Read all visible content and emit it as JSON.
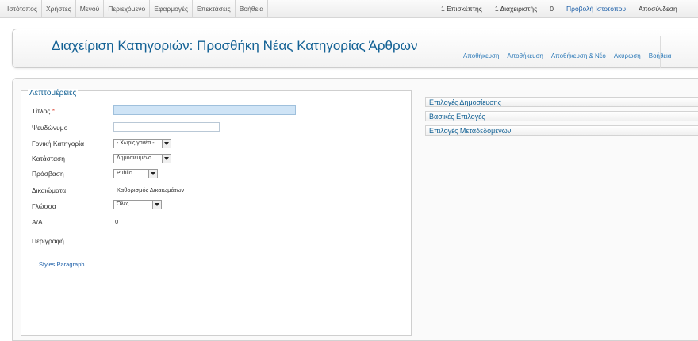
{
  "topmenu": [
    "Ιστότοπος",
    "Χρήστες",
    "Μενού",
    "Περιεχόμενο",
    "Εφαρμογές",
    "Επεκτάσεις",
    "Βοήθεια"
  ],
  "status": {
    "visitors": "1 Επισκέπτης",
    "admins": "1 Διαχειριστής",
    "messages": "0",
    "view_site": "Προβολή Ιστοτόπου",
    "logout": "Αποσύνδεση"
  },
  "header": {
    "title": "Διαχείριση Κατηγοριών: Προσθήκη Νέας Κατηγορίας Άρθρων",
    "toolbar": [
      "Αποθήκευση",
      "Αποθήκευση",
      "Αποθήκευση & Νέο",
      "Ακύρωση",
      "Βοήθεια"
    ]
  },
  "details": {
    "legend": "Λεπτομέρειες",
    "title_label": "Τίτλος",
    "required_mark": "*",
    "alias_label": "Ψευδώνυμο",
    "parent_label": "Γονική Κατηγορία",
    "parent_value": "- Χωρίς γονέα -",
    "state_label": "Κατάσταση",
    "state_value": "Δημοσιευμένο",
    "access_label": "Πρόσβαση",
    "access_value": "Public",
    "permissions_label": "Δικαιώματα",
    "permissions_value": "Καθορισμός Δικαιωμάτων",
    "language_label": "Γλώσσα",
    "language_value": "Όλες",
    "id_label": "Α/Α",
    "id_value": "0",
    "description_label": "Περιγραφή",
    "editor_toolbar": "Styles Paragraph"
  },
  "panels": [
    "Επιλογές Δημοσίευσης",
    "Βασικές Επιλογές",
    "Επιλογές Μεταδεδομένων"
  ]
}
